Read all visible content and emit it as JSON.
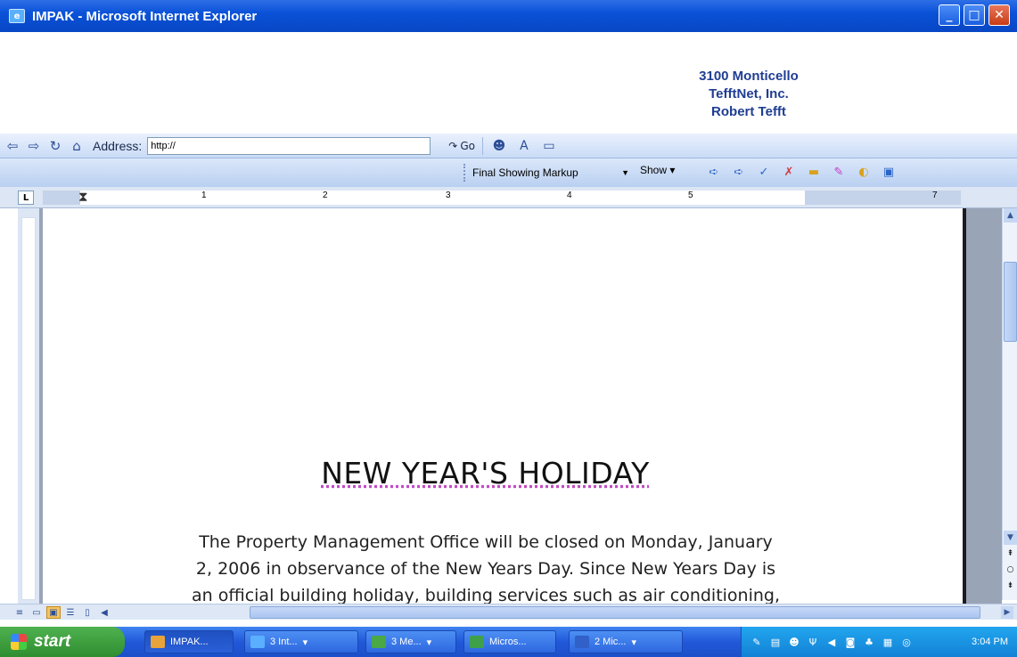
{
  "window": {
    "title": "IMPAK - Microsoft Internet Explorer",
    "buttons": {
      "minimize": "_",
      "maximize": "□",
      "close": "✕"
    }
  },
  "header": {
    "address_lines": [
      "3100 Monticello",
      "TefftNet, Inc.",
      "Robert Tefft"
    ]
  },
  "navbar": {
    "address_label": "Address:",
    "address_value": "http://",
    "go_label": "Go"
  },
  "markup_toolbar": {
    "display_mode": "Final Showing Markup",
    "show_label": "Show ▾"
  },
  "ruler": {
    "tab_selector": "L",
    "numbers": [
      "1",
      "2",
      "3",
      "4",
      "5",
      "7"
    ]
  },
  "document": {
    "headline": "NEW YEAR'S HOLIDAY",
    "body_lines": [
      "The Property Management Office will be closed on Monday, January",
      "2, 2006 in observance of the New Years Day.  Since New Years Day is",
      "an official building holiday, building services such as air conditioning,"
    ]
  },
  "taskbar": {
    "start_label": "start",
    "tasks": [
      {
        "label": "IMPAK...",
        "color": "#e8a33a"
      },
      {
        "label": "3 Int...",
        "color": "#5ab0ff"
      },
      {
        "label": "3 Me...",
        "color": "#4aa845"
      },
      {
        "label": "Micros...",
        "color": "#3fa04a"
      },
      {
        "label": "2 Mic...",
        "color": "#3060c8"
      }
    ],
    "clock": "3:04 PM"
  }
}
